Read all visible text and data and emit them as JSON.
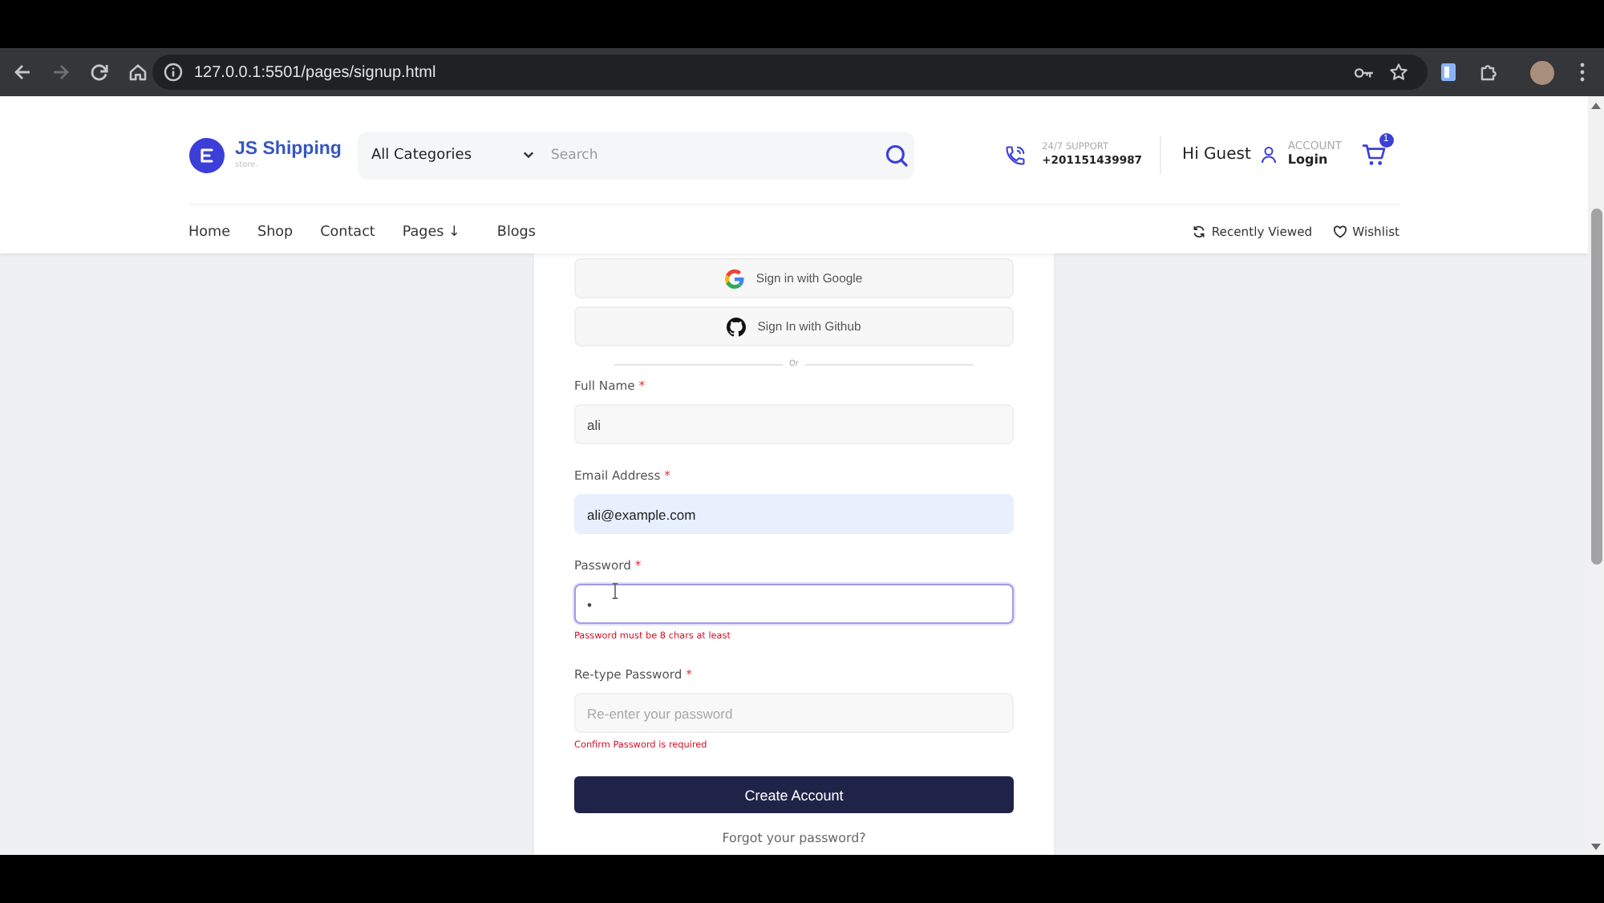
{
  "browser": {
    "url": "127.0.0.1:5501/pages/signup.html"
  },
  "header": {
    "brand": {
      "name": "JS Shipping",
      "tagline": "store."
    },
    "search": {
      "category": "All Categories",
      "placeholder": "Search"
    },
    "support": {
      "label": "24/7 SUPPORT",
      "phone": "+201151439987"
    },
    "greeting": "Hi Guest",
    "account": {
      "label": "ACCOUNT",
      "action": "Login"
    },
    "cart": {
      "count": "1"
    }
  },
  "nav": {
    "items": [
      {
        "label": "Home"
      },
      {
        "label": "Shop"
      },
      {
        "label": "Contact"
      },
      {
        "label": "Pages ↓"
      },
      {
        "label": "Blogs"
      }
    ],
    "links": [
      {
        "kind": "recent",
        "label": "Recently Viewed"
      },
      {
        "kind": "wishlist",
        "label": "Wishlist"
      }
    ]
  },
  "form": {
    "social": [
      {
        "kind": "google",
        "label": "Sign in with Google"
      },
      {
        "kind": "github",
        "label": "Sign In with Github"
      }
    ],
    "divider": "Or",
    "fields": [
      {
        "label": "Full Name",
        "required_mark": "*",
        "value": "ali",
        "focused": false,
        "autofilled": false
      },
      {
        "label": "Email Address",
        "required_mark": "*",
        "value": "ali@example.com",
        "focused": false,
        "autofilled": true
      },
      {
        "label": "Password",
        "required_mark": "*",
        "value": "•",
        "focused": true,
        "autofilled": false,
        "error": "Password must be 8 chars at least"
      },
      {
        "label": "Re-type Password",
        "required_mark": "*",
        "placeholder": "Re-enter your password",
        "focused": false,
        "autofilled": false,
        "error": "Confirm Password is required"
      }
    ],
    "submit": "Create Account",
    "forgot": "Forgot your password?"
  }
}
